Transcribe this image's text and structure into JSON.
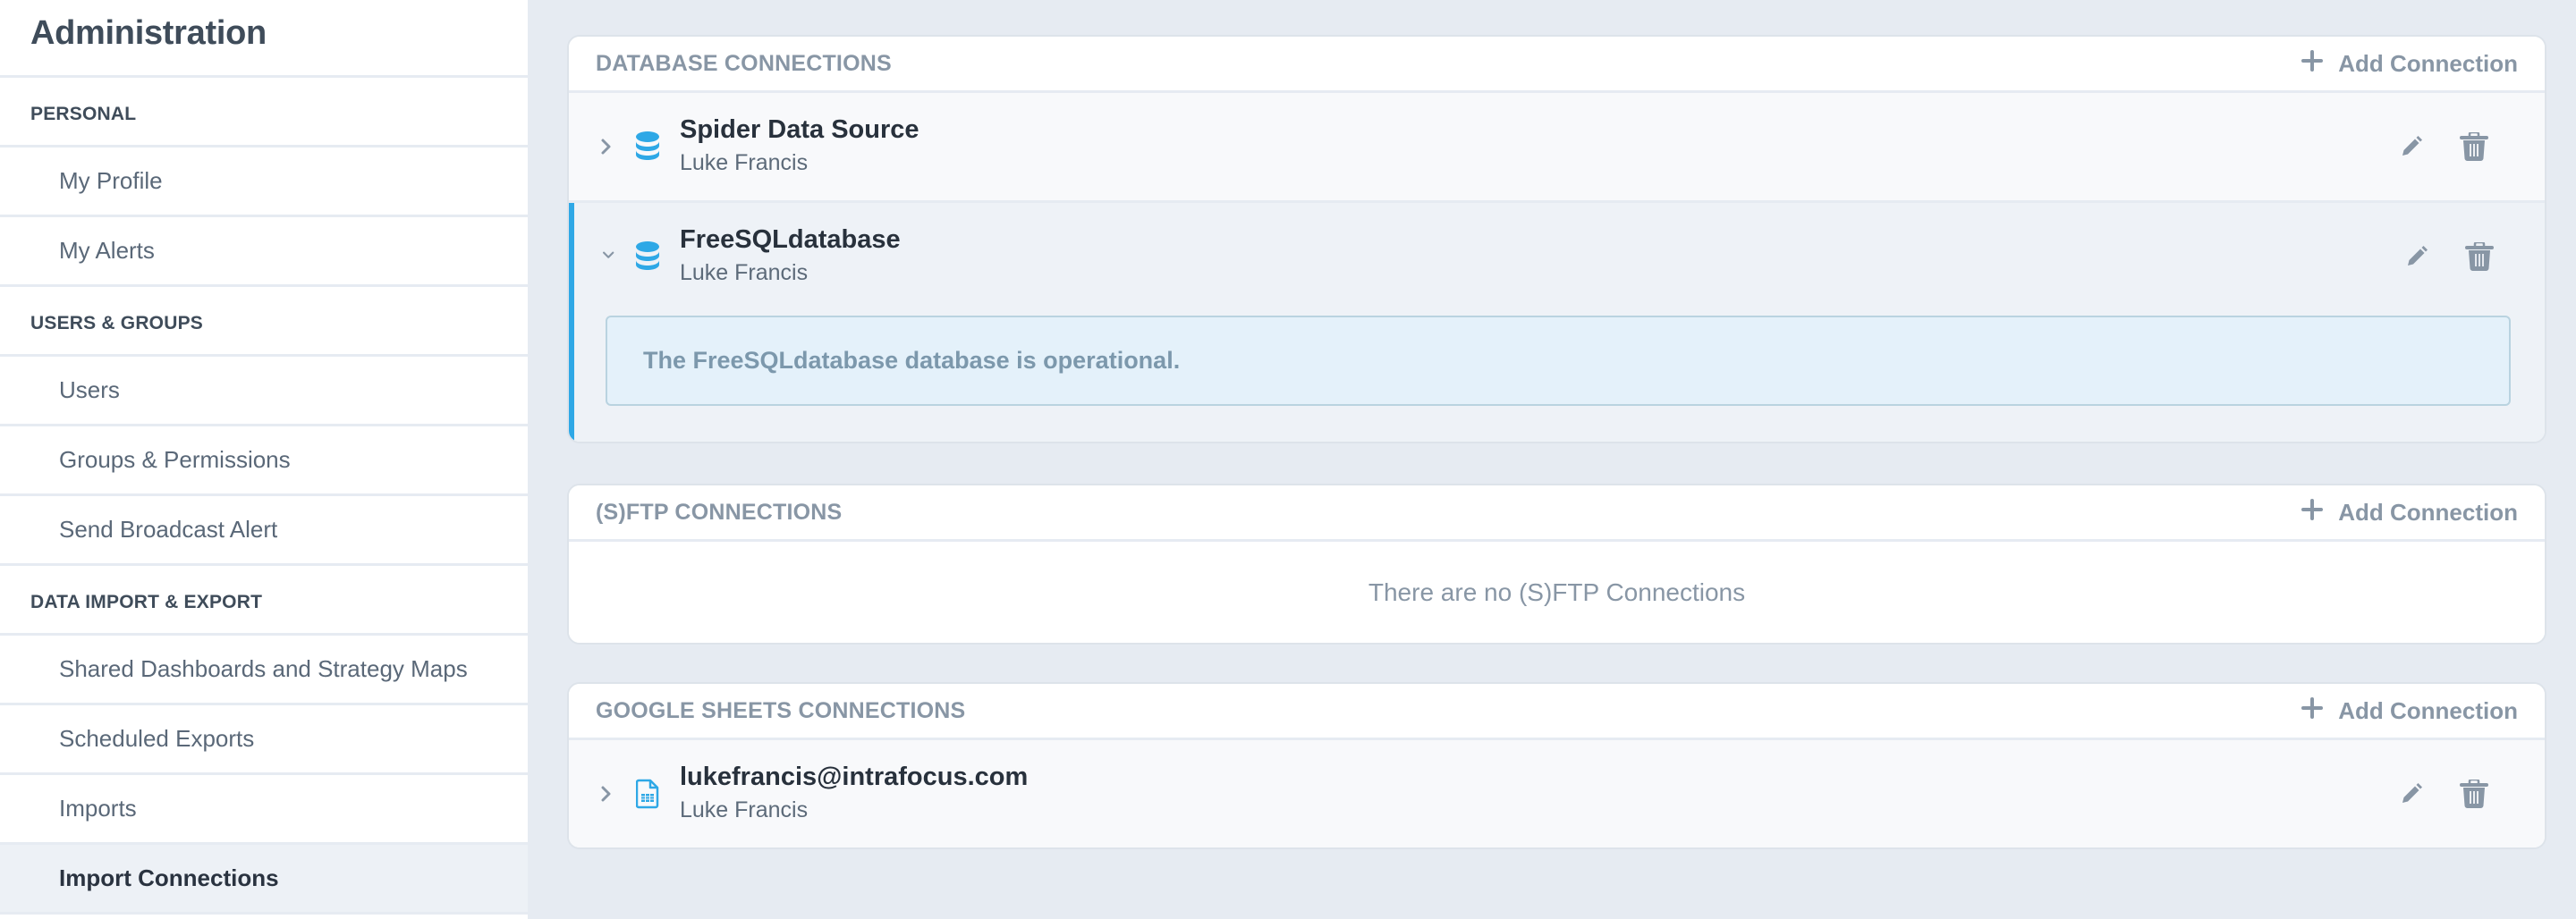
{
  "sidebar": {
    "title": "Administration",
    "sections": [
      {
        "label": "PERSONAL",
        "items": [
          "My Profile",
          "My Alerts"
        ]
      },
      {
        "label": "USERS & GROUPS",
        "items": [
          "Users",
          "Groups & Permissions",
          "Send Broadcast Alert"
        ]
      },
      {
        "label": "DATA IMPORT & EXPORT",
        "items": [
          "Shared Dashboards and Strategy Maps",
          "Scheduled Exports",
          "Imports",
          "Import Connections"
        ]
      }
    ],
    "active_item": "Import Connections"
  },
  "cards": {
    "database": {
      "title": "DATABASE CONNECTIONS",
      "add_label": "Add Connection",
      "rows": [
        {
          "name": "Spider Data Source",
          "owner": "Luke Francis",
          "icon": "database-icon",
          "expanded": false
        },
        {
          "name": "FreeSQLdatabase",
          "owner": "Luke Francis",
          "icon": "database-icon",
          "expanded": true,
          "status_message": "The FreeSQLdatabase database is operational."
        }
      ]
    },
    "sftp": {
      "title": "(S)FTP CONNECTIONS",
      "add_label": "Add Connection",
      "empty_message": "There are no (S)FTP Connections"
    },
    "sheets": {
      "title": "GOOGLE SHEETS CONNECTIONS",
      "add_label": "Add Connection",
      "rows": [
        {
          "name": "lukefrancis@intrafocus.com",
          "owner": "Luke Francis",
          "icon": "spreadsheet-icon",
          "expanded": false
        }
      ]
    }
  },
  "colors": {
    "accent": "#2ea8e6",
    "icon_gray": "#8896a5",
    "background": "#e6ebf2",
    "alert_bg": "#e4f1fa"
  }
}
